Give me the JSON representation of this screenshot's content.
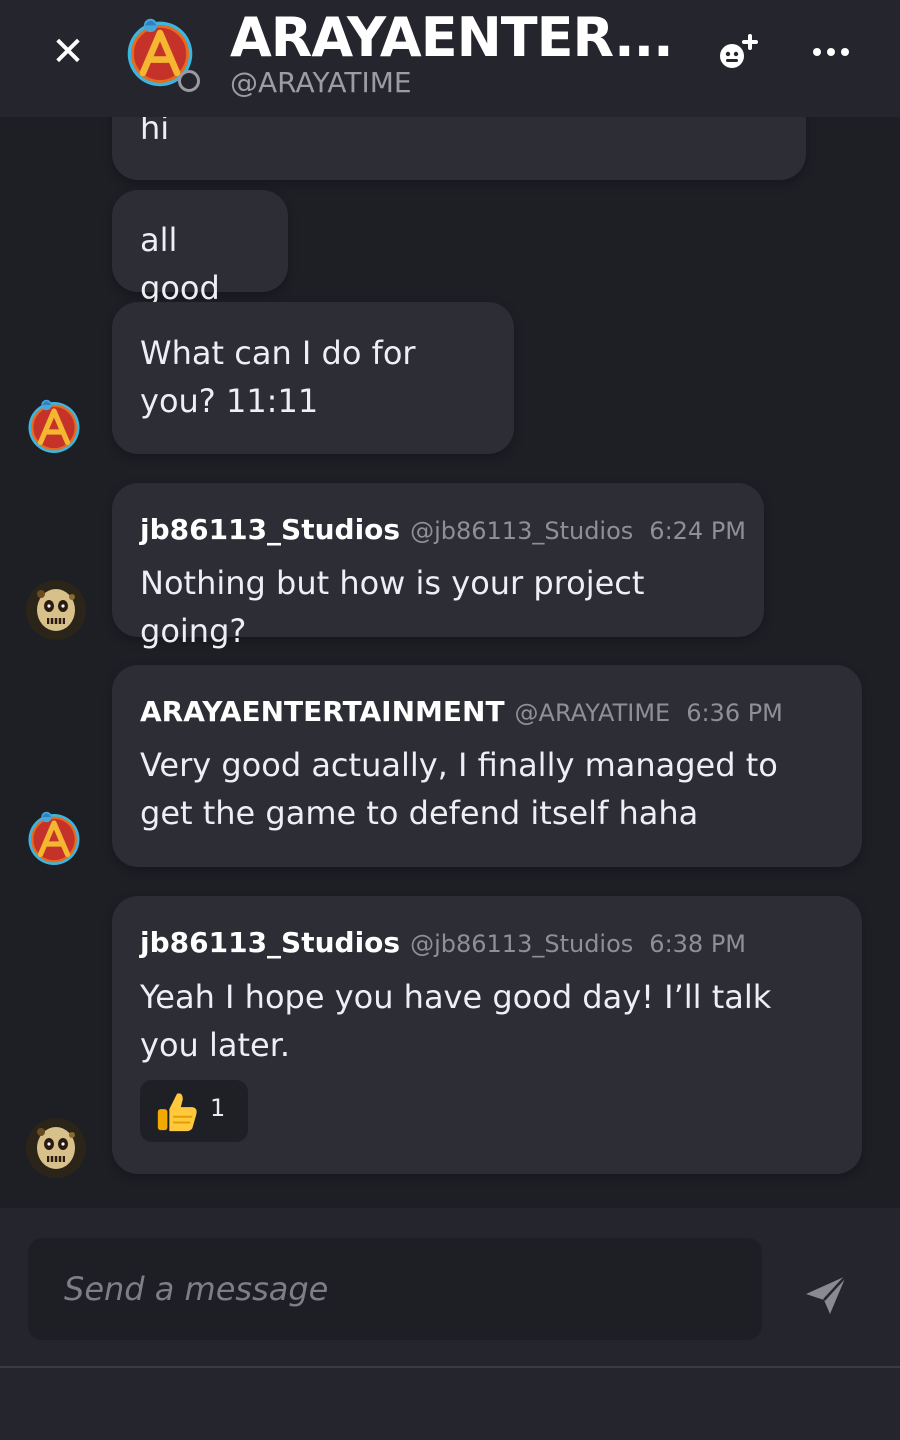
{
  "header": {
    "close_symbol": "✕",
    "name": "ARAYAENTER...",
    "handle": "@ARAYATIME",
    "icons": {
      "close": "close-icon",
      "add_friend": "add-friend-icon",
      "more": "more-icon"
    }
  },
  "messages": [
    {
      "text": "hi"
    },
    {
      "text": "all good"
    },
    {
      "text": "What can I do for you? 11:11"
    },
    {
      "author": "jb86113_Studios",
      "handle": "@jb86113_Studios",
      "time": "6:24 PM",
      "text": "Nothing but how is your project going?"
    },
    {
      "author": "ARAYAENTERTAINMENT",
      "handle": "@ARAYATIME",
      "time": "6:36 PM",
      "text": "Very good actually, I finally managed to get the game to defend itself haha"
    },
    {
      "author": "jb86113_Studios",
      "handle": "@jb86113_Studios",
      "time": "6:38 PM",
      "text": "Yeah I hope you have good day! I’ll talk you later.",
      "reaction": {
        "icon": "thumbs-up-icon",
        "count": "1"
      }
    }
  ],
  "composer": {
    "placeholder": "Send a message",
    "value": "",
    "send_icon": "send-icon"
  },
  "colors": {
    "background": "#1e1f25",
    "header": "#25262d",
    "bubble": "#2c2d35",
    "muted_text": "#8f8f99",
    "avatar_red": "#c4322a",
    "avatar_ring": "#3bb6e0"
  }
}
